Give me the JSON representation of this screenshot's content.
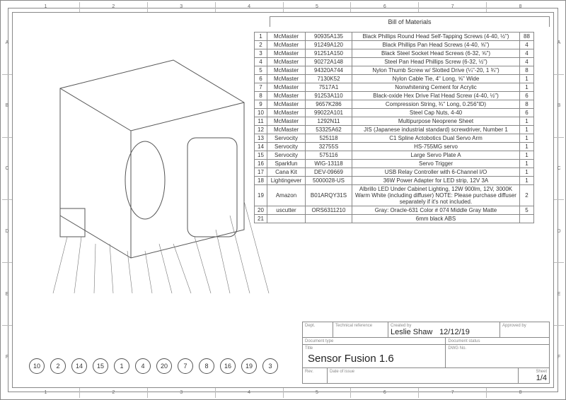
{
  "rulers": {
    "cols": [
      "1",
      "2",
      "3",
      "4",
      "5",
      "6",
      "7",
      "8"
    ],
    "rows": [
      "A",
      "B",
      "C",
      "D",
      "E",
      "F"
    ]
  },
  "bom": {
    "title": "Bill of Materials",
    "rows": [
      {
        "n": "1",
        "vendor": "McMaster",
        "part": "90935A135",
        "desc": "Black Phillips Round Head Self-Tapping Screws (4-40, ½\")",
        "qty": "88"
      },
      {
        "n": "2",
        "vendor": "McMaster",
        "part": "91249A120",
        "desc": "Black Phillips Pan Head Screws (4-40, ⅝\")",
        "qty": "4"
      },
      {
        "n": "3",
        "vendor": "McMaster",
        "part": "91251A150",
        "desc": "Black Steel Socket Head Screws (6-32, ⅝\")",
        "qty": "4"
      },
      {
        "n": "4",
        "vendor": "McMaster",
        "part": "90272A148",
        "desc": "Steel Pan Head Phillips Screw (6-32, ½\")",
        "qty": "4"
      },
      {
        "n": "5",
        "vendor": "McMaster",
        "part": "94320A744",
        "desc": "Nylon Thumb Screw w/ Slotted Drive (¼\"-20, 1 ¾\")",
        "qty": "8"
      },
      {
        "n": "6",
        "vendor": "McMaster",
        "part": "7130K52",
        "desc": "Nylon Cable Tie, 4\" Long, ⅝\" Wide",
        "qty": "1"
      },
      {
        "n": "7",
        "vendor": "McMaster",
        "part": "7517A1",
        "desc": "Nonwhitening Cement for Acrylic",
        "qty": "1"
      },
      {
        "n": "8",
        "vendor": "McMaster",
        "part": "91253A110",
        "desc": "Black-oxide Hex Drive Flat Head Screw (4-40, ½\")",
        "qty": "6"
      },
      {
        "n": "9",
        "vendor": "McMaster",
        "part": "9657K286",
        "desc": "Compression String, ¾\" Long, 0.256\"ID)",
        "qty": "8"
      },
      {
        "n": "10",
        "vendor": "McMaster",
        "part": "99022A101",
        "desc": "Steel Cap Nuts, 4-40",
        "qty": "6"
      },
      {
        "n": "11",
        "vendor": "McMaster",
        "part": "1292N11",
        "desc": "Multipurpose Neoprene Sheet",
        "qty": "1"
      },
      {
        "n": "12",
        "vendor": "McMaster",
        "part": "53325A62",
        "desc": "JIS (Japanese industrial standard) screwdriver, Number 1",
        "qty": "1"
      },
      {
        "n": "13",
        "vendor": "Servocity",
        "part": "525118",
        "desc": "C1 Spline Actobotics Dual Servo Arm",
        "qty": "1"
      },
      {
        "n": "14",
        "vendor": "Servocity",
        "part": "32755S",
        "desc": "HS-755MG servo",
        "qty": "1"
      },
      {
        "n": "15",
        "vendor": "Servocity",
        "part": "575116",
        "desc": "Large Servo Plate A",
        "qty": "1"
      },
      {
        "n": "16",
        "vendor": "Sparkfun",
        "part": "WIG-13118",
        "desc": "Servo Trigger",
        "qty": "1"
      },
      {
        "n": "17",
        "vendor": "Cana Kit",
        "part": "DEV-09669",
        "desc": "USB Relay Controller with 6-Channel I/O",
        "qty": "1"
      },
      {
        "n": "18",
        "vendor": "Lightingever",
        "part": "5000028-US",
        "desc": "36W Power Adapter for LED strip, 12V 3A",
        "qty": "1"
      },
      {
        "n": "19",
        "vendor": "Amazon",
        "part": "B01ARQY31S",
        "desc": "Albrillo LED Under Cabinet Lighting, 12W 900lm, 12V, 3000K Warm White (including diffuser) NOTE: Please purchase diffuser separately if it's not included.",
        "qty": "2"
      },
      {
        "n": "20",
        "vendor": "uscutter",
        "part": "ORS6311210",
        "desc": "Gray: Oracle-631 Color # 074 Middle Gray Matte",
        "qty": "5"
      },
      {
        "n": "21",
        "vendor": "",
        "part": "",
        "desc": "6mm black ABS",
        "qty": ""
      }
    ]
  },
  "balloons": [
    "10",
    "2",
    "14",
    "15",
    "1",
    "4",
    "20",
    "7",
    "8",
    "16",
    "19",
    "3"
  ],
  "titleblock": {
    "labels": {
      "dept": "Dept.",
      "techref": "Technical reference",
      "created": "Created by",
      "approved": "Approved by",
      "doctype": "Document type",
      "docstatus": "Document status",
      "title": "Title",
      "dwg": "DWG No.",
      "rev": "Rev.",
      "date": "Date of issue",
      "sheet": "Sheet"
    },
    "created_by": "Leslie Shaw",
    "created_date": "12/12/19",
    "title": "Sensor Fusion 1.6",
    "sheet": "1/4"
  }
}
